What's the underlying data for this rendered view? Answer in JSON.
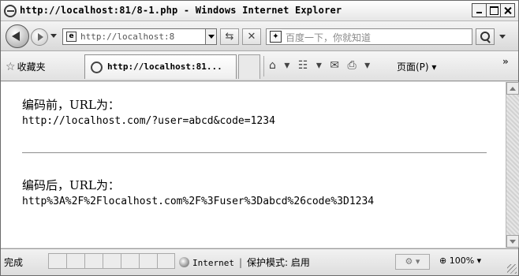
{
  "window": {
    "title": "http://localhost:81/8-1.php - Windows Internet Explorer"
  },
  "nav": {
    "address": "http://localhost:8",
    "search_placeholder": "百度一下，你就知道"
  },
  "commandbar": {
    "favorites_label": "收藏夹",
    "tab_title": "http://localhost:81...",
    "page_menu": "页面(P)",
    "more": "»"
  },
  "content": {
    "before_label": "编码前，URL为：",
    "before_url": "http://localhost.com/?user=abcd&code=1234",
    "after_label": "编码后，URL为：",
    "after_url": "http%3A%2F%2Flocalhost.com%2F%3Fuser%3Dabcd%26code%3D1234"
  },
  "statusbar": {
    "status": "完成",
    "zone": "Internet",
    "separator": "|",
    "protected_mode": "保护模式: 启用",
    "zoom": "100%"
  },
  "icons": {
    "back": "back-arrow-icon",
    "forward": "forward-arrow-icon",
    "refresh": "refresh-icon",
    "stop": "stop-icon",
    "search": "magnifier-icon",
    "favorites": "star-icon",
    "home": "home-icon",
    "feeds": "rss-icon",
    "mail": "mail-icon",
    "print": "printer-icon",
    "zone": "globe-icon",
    "zoom": "zoom-icon"
  }
}
